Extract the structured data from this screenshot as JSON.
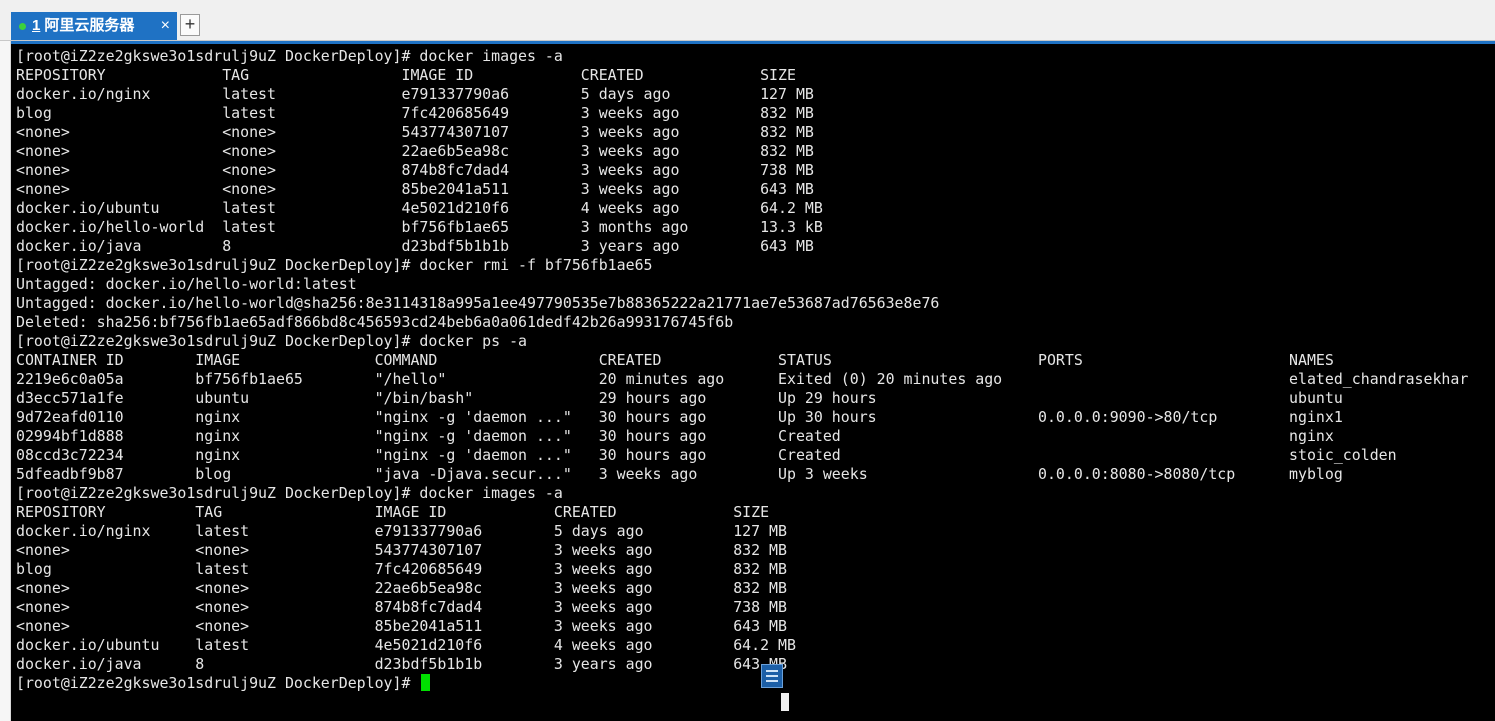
{
  "tabbar": {
    "tab": {
      "number": "1",
      "title": "阿里云服务器",
      "close": "×"
    },
    "new_tab": "+"
  },
  "colors": {
    "tab_active": "#1f72c4",
    "terminal_bg": "#000000",
    "text": "#e6e6e6",
    "cursor": "#00e000"
  },
  "terminal": {
    "lines": [
      "[root@iZ2ze2gkswe3o1sdrulj9uZ DockerDeploy]# docker images -a",
      "REPOSITORY             TAG                 IMAGE ID            CREATED             SIZE",
      "docker.io/nginx        latest              e791337790a6        5 days ago          127 MB",
      "blog                   latest              7fc420685649        3 weeks ago         832 MB",
      "<none>                 <none>              543774307107        3 weeks ago         832 MB",
      "<none>                 <none>              22ae6b5ea98c        3 weeks ago         832 MB",
      "<none>                 <none>              874b8fc7dad4        3 weeks ago         738 MB",
      "<none>                 <none>              85be2041a511        3 weeks ago         643 MB",
      "docker.io/ubuntu       latest              4e5021d210f6        4 weeks ago         64.2 MB",
      "docker.io/hello-world  latest              bf756fb1ae65        3 months ago        13.3 kB",
      "docker.io/java         8                   d23bdf5b1b1b        3 years ago         643 MB",
      "[root@iZ2ze2gkswe3o1sdrulj9uZ DockerDeploy]# docker rmi -f bf756fb1ae65",
      "Untagged: docker.io/hello-world:latest",
      "Untagged: docker.io/hello-world@sha256:8e3114318a995a1ee497790535e7b88365222a21771ae7e53687ad76563e8e76",
      "Deleted: sha256:bf756fb1ae65adf866bd8c456593cd24beb6a0a061dedf42b26a993176745f6b",
      "[root@iZ2ze2gkswe3o1sdrulj9uZ DockerDeploy]# docker ps -a",
      "CONTAINER ID        IMAGE               COMMAND                  CREATED             STATUS                       PORTS                       NAMES",
      "2219e6c0a05a        bf756fb1ae65        \"/hello\"                 20 minutes ago      Exited (0) 20 minutes ago                                elated_chandrasekhar",
      "d3ecc571a1fe        ubuntu              \"/bin/bash\"              29 hours ago        Up 29 hours                                              ubuntu",
      "9d72eafd0110        nginx               \"nginx -g 'daemon ...\"   30 hours ago        Up 30 hours                  0.0.0.0:9090->80/tcp        nginx1",
      "02994bf1d888        nginx               \"nginx -g 'daemon ...\"   30 hours ago        Created                                                  nginx",
      "08ccd3c72234        nginx               \"nginx -g 'daemon ...\"   30 hours ago        Created                                                  stoic_colden",
      "5dfeadbf9b87        blog                \"java -Djava.secur...\"   3 weeks ago         Up 3 weeks                   0.0.0.0:8080->8080/tcp      myblog",
      "[root@iZ2ze2gkswe3o1sdrulj9uZ DockerDeploy]# docker images -a",
      "REPOSITORY          TAG                 IMAGE ID            CREATED             SIZE",
      "docker.io/nginx     latest              e791337790a6        5 days ago          127 MB",
      "<none>              <none>              543774307107        3 weeks ago         832 MB",
      "blog                latest              7fc420685649        3 weeks ago         832 MB",
      "<none>              <none>              22ae6b5ea98c        3 weeks ago         832 MB",
      "<none>              <none>              874b8fc7dad4        3 weeks ago         738 MB",
      "<none>              <none>              85be2041a511        3 weeks ago         643 MB",
      "docker.io/ubuntu    latest              4e5021d210f6        4 weeks ago         64.2 MB",
      "docker.io/java      8                   d23bdf5b1b1b        3 years ago         643 MB"
    ],
    "prompt": "[root@iZ2ze2gkswe3o1sdrulj9uZ DockerDeploy]# "
  }
}
